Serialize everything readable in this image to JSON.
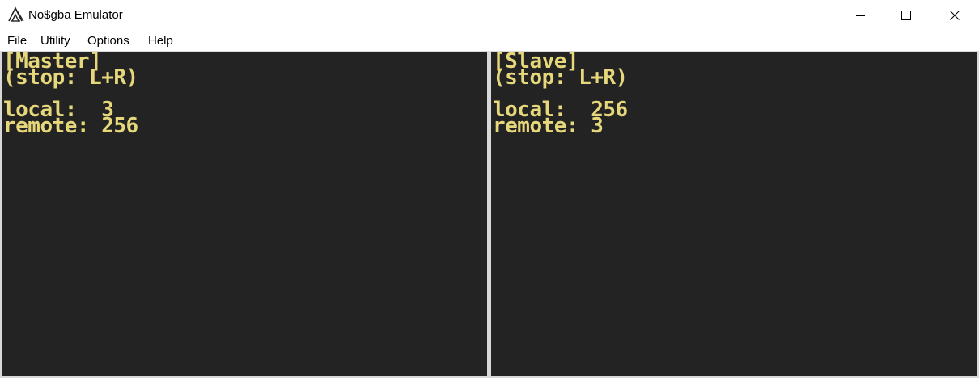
{
  "window": {
    "title": "No$gba Emulator",
    "icon": "no-gba-logo-icon",
    "controls": {
      "minimize": "minimize-icon",
      "maximize": "maximize-icon",
      "close": "close-icon"
    }
  },
  "menu": {
    "items": [
      {
        "label": "File"
      },
      {
        "label": "Utility"
      },
      {
        "label": "Options"
      },
      {
        "label": "Help"
      }
    ]
  },
  "screens": {
    "text_color": "#e6d77a",
    "background_color": "#232323",
    "master": {
      "header": "[Master]",
      "stop_hint": "(stop: L+R)",
      "local_line": "local:  3",
      "remote_line": "remote: 256"
    },
    "slave": {
      "header": "[Slave]",
      "stop_hint": "(stop: L+R)",
      "local_line": "local:  256",
      "remote_line": "remote: 3"
    }
  }
}
